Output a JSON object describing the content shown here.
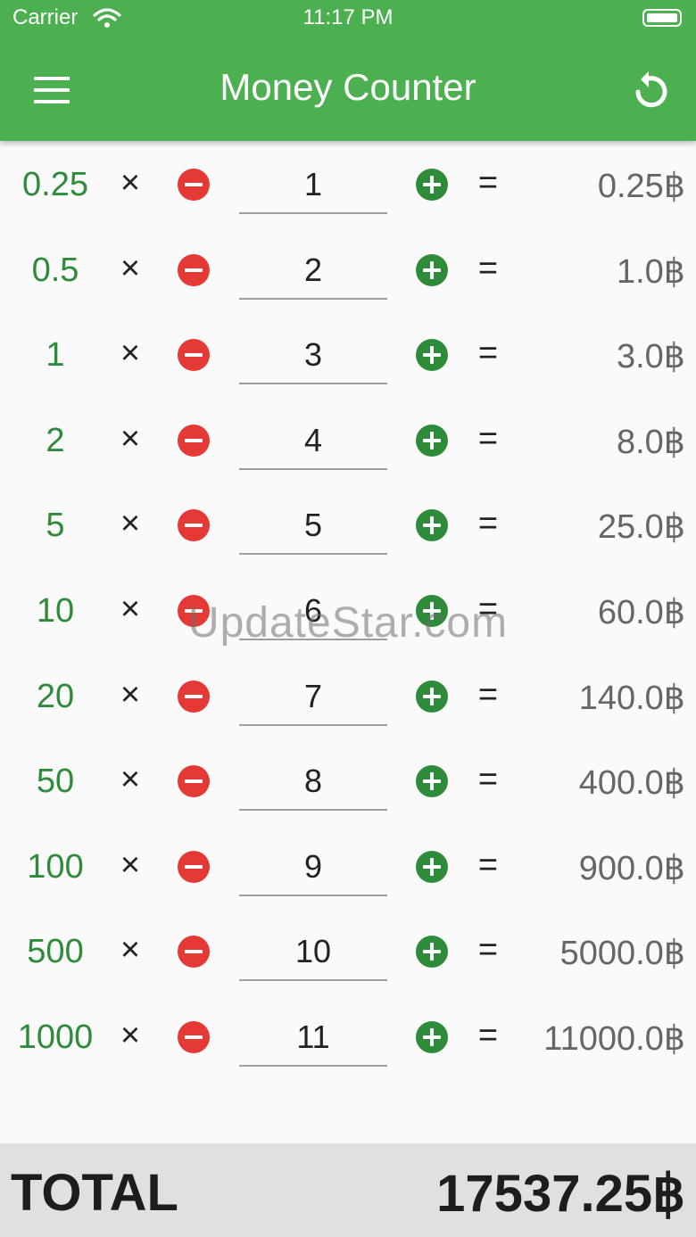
{
  "status_bar": {
    "carrier": "Carrier",
    "time": "11:17 PM"
  },
  "app_bar": {
    "title": "Money Counter",
    "menu_icon": "hamburger-menu-icon",
    "reset_icon": "reset-refresh-icon"
  },
  "colors": {
    "primary": "#4caf50",
    "denomination": "#2e8b3a",
    "minus": "#e53935",
    "plus": "#2e8b3a",
    "total_bar": "#e0e0e0"
  },
  "symbols": {
    "times": "×",
    "equals": "="
  },
  "rows": [
    {
      "denomination": "0.25",
      "quantity": "1",
      "amount": "0.25฿"
    },
    {
      "denomination": "0.5",
      "quantity": "2",
      "amount": "1.0฿"
    },
    {
      "denomination": "1",
      "quantity": "3",
      "amount": "3.0฿"
    },
    {
      "denomination": "2",
      "quantity": "4",
      "amount": "8.0฿"
    },
    {
      "denomination": "5",
      "quantity": "5",
      "amount": "25.0฿"
    },
    {
      "denomination": "10",
      "quantity": "6",
      "amount": "60.0฿"
    },
    {
      "denomination": "20",
      "quantity": "7",
      "amount": "140.0฿"
    },
    {
      "denomination": "50",
      "quantity": "8",
      "amount": "400.0฿"
    },
    {
      "denomination": "100",
      "quantity": "9",
      "amount": "900.0฿"
    },
    {
      "denomination": "500",
      "quantity": "10",
      "amount": "5000.0฿"
    },
    {
      "denomination": "1000",
      "quantity": "11",
      "amount": "11000.0฿"
    }
  ],
  "total": {
    "label": "TOTAL",
    "value": "17537.25฿"
  },
  "watermark": "UpdateStar.com"
}
